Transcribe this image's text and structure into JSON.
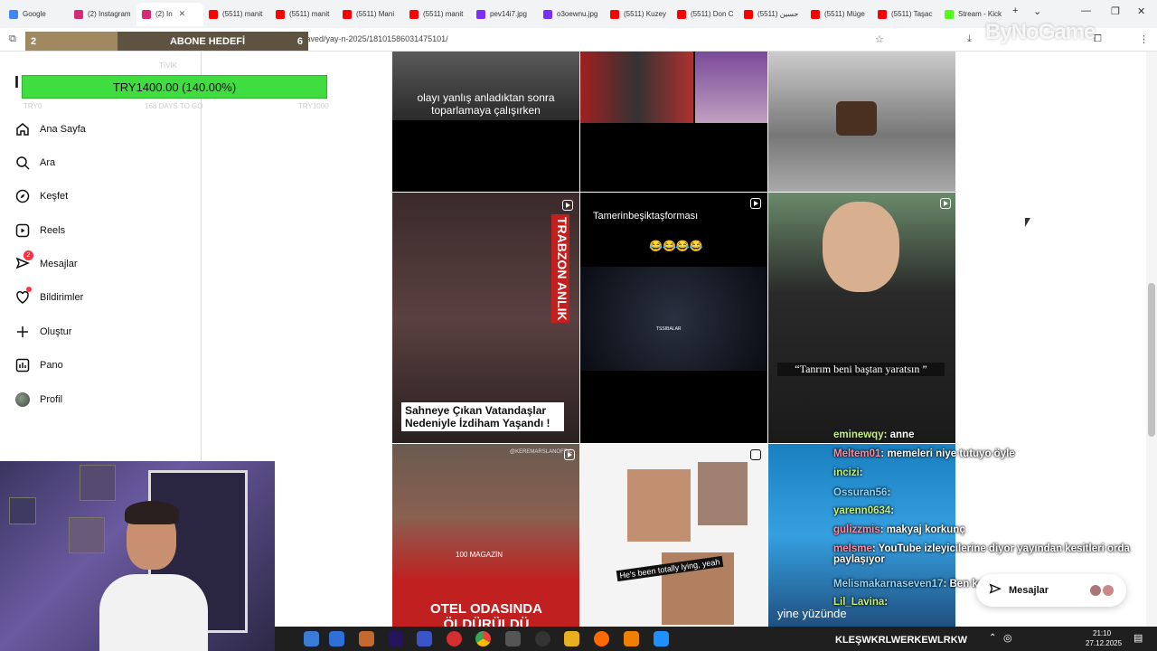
{
  "browser": {
    "tabs": [
      {
        "label": "Google",
        "color": "#4285f4"
      },
      {
        "label": "(2) Instagram",
        "color": "#d62976"
      },
      {
        "label": "(2) In",
        "color": "#d62976"
      },
      {
        "label": "(5511) manit",
        "color": "#ff0000"
      },
      {
        "label": "(5511) manit",
        "color": "#ff0000"
      },
      {
        "label": "(5511) Mani",
        "color": "#ff0000"
      },
      {
        "label": "(5511) manit",
        "color": "#ff0000"
      },
      {
        "label": "pev14i7.jpg",
        "color": "#7b2ff7"
      },
      {
        "label": "o3oewnu.jpg",
        "color": "#7b2ff7"
      },
      {
        "label": "(5511) Kuzey",
        "color": "#ff0000"
      },
      {
        "label": "(5511) Don C",
        "color": "#ff0000"
      },
      {
        "label": "حسين (5511)",
        "color": "#ff0000"
      },
      {
        "label": "(5511) Müge",
        "color": "#ff0000"
      },
      {
        "label": "(5511) Taşac",
        "color": "#ff0000"
      },
      {
        "label": "Stream - Kick",
        "color": "#53fc18"
      }
    ],
    "url": "www.instagram.com/tame          /saved/yay-n-2025/18101586031475101/"
  },
  "overlay": {
    "sub_count": "2",
    "sub_label": "ABONE HEDEFİ",
    "sub_target": "6",
    "faint_label": "TİVİK",
    "faint_left": "TRY0",
    "faint_mid": "168 DAYS TO GO",
    "faint_right": "TRY1000",
    "goal_text": "TRY1400.00 (140.00%)",
    "watermark": "ByNoGame"
  },
  "sidebar": {
    "logo": "I",
    "items": [
      {
        "label": "Ana Sayfa",
        "icon": "home-icon"
      },
      {
        "label": "Ara",
        "icon": "search-icon"
      },
      {
        "label": "Keşfet",
        "icon": "compass-icon"
      },
      {
        "label": "Reels",
        "icon": "reels-icon"
      },
      {
        "label": "Mesajlar",
        "icon": "messenger-icon",
        "badge": "2"
      },
      {
        "label": "Bildirimler",
        "icon": "heart-icon"
      },
      {
        "label": "Oluştur",
        "icon": "plus-icon"
      },
      {
        "label": "Pano",
        "icon": "dashboard-icon"
      },
      {
        "label": "Profil",
        "icon": "avatar"
      }
    ]
  },
  "posts": {
    "p1_caption": "olayı yanlış anladıktan sonra toparlamaya çalışırken",
    "p4_side": "TRABZON ANLIK",
    "p4_caption": "Sahneye Çıkan Vatandaşlar Nedeniyle İzdiham Yaşandı !",
    "p5_caption": "Tamerinbeşiktaşforması",
    "p5_emoji": "😂😂😂😂",
    "p5_logo": "TSSIBALAR",
    "p6_caption": "“Tanrım beni baştan yaratsın ”",
    "p7_handle": "@KEREMARSLANOFFIC",
    "p7_watermark": "100 MAGAZİN",
    "p7_caption": "OTEL ODASINDA ÖLDÜRÜLDÜ",
    "p8_caption": "He's been totally lying, yeah",
    "p9_caption": "yine yüzünde"
  },
  "chat": [
    {
      "user": "Meltem01",
      "text": ": memeleri niye tutuyo öyle"
    },
    {
      "user": "incizi",
      "text": ":"
    },
    {
      "user": "Ossuran56",
      "text": ":"
    },
    {
      "user": "yarenn0634",
      "text": ":"
    },
    {
      "user": "gulizzmis",
      "text": ": makyaj korkunç"
    },
    {
      "user": "melsme",
      "text": ": YouTube izleyicilerine diyor yayından kesitleri orda paylaşıyor"
    },
    {
      "user": "Melismakarnaseven17",
      "text": ": Ben kadınım"
    },
    {
      "user": "Lil_Lavina",
      "text": ":"
    },
    {
      "user": "eminewqy",
      "text": ": anne"
    }
  ],
  "messages_pill": {
    "label": "Mesajlar"
  },
  "taskbar": {
    "stream_name": "KLEŞWKRLWERKEWLRKW",
    "time": "21:10",
    "date": "27.12.2025"
  }
}
